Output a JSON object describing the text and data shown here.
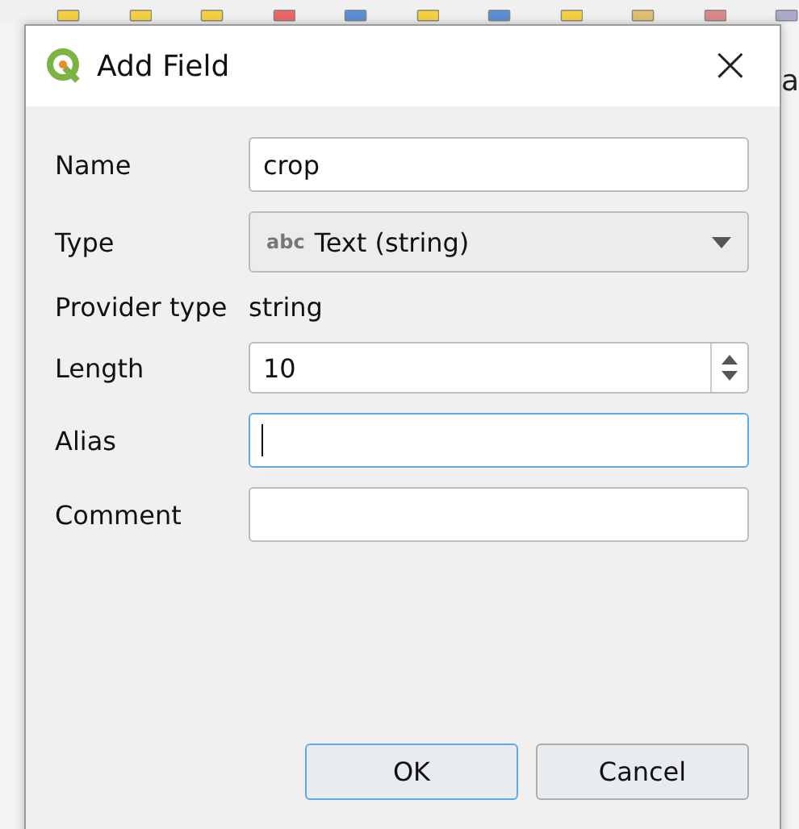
{
  "background": {
    "fragment_text": "a"
  },
  "window": {
    "title": "Add Field",
    "close": "×"
  },
  "form": [
    {
      "kind": "text",
      "label": "Name",
      "value": "crop",
      "focused": false
    },
    {
      "kind": "combo",
      "label": "Type",
      "prefix": "abc",
      "value": "Text (string)"
    },
    {
      "kind": "static",
      "label": "Provider type",
      "value": "string"
    },
    {
      "kind": "spin",
      "label": "Length",
      "value": "10",
      "focused": false
    },
    {
      "kind": "text",
      "label": "Alias",
      "focused": true
    },
    {
      "kind": "text",
      "label": "Comment",
      "focused": false
    }
  ],
  "buttons": [
    {
      "label": "OK",
      "default": true
    },
    {
      "label": "Cancel",
      "default": false
    }
  ]
}
